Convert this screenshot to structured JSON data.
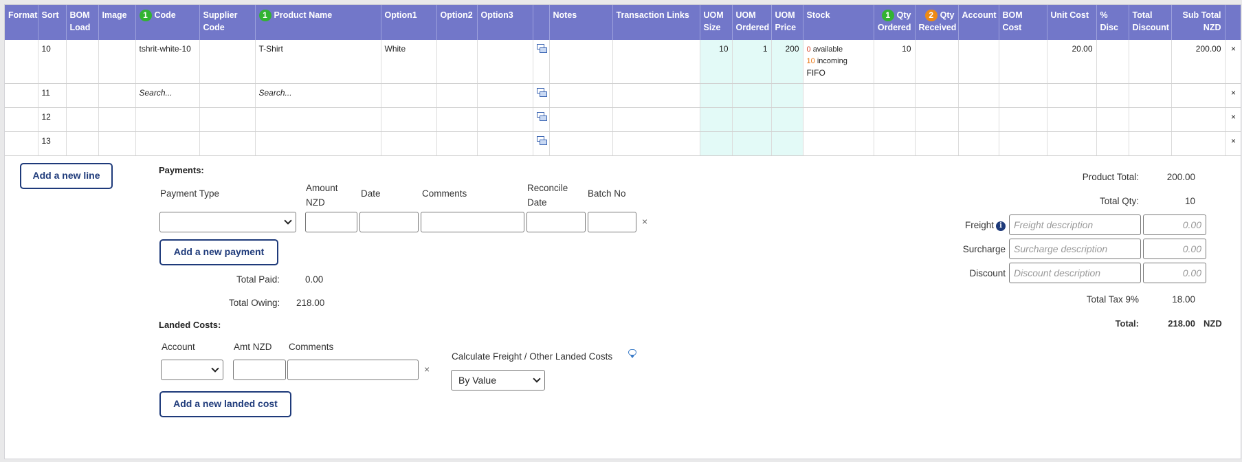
{
  "columns": [
    {
      "key": "format",
      "label": "Format"
    },
    {
      "key": "sort",
      "label": "Sort"
    },
    {
      "key": "bom_load",
      "label": "BOM Load"
    },
    {
      "key": "image",
      "label": "Image"
    },
    {
      "key": "code",
      "label": "Code",
      "badge": "1",
      "badge_color": "green"
    },
    {
      "key": "supplier_code",
      "label": "Supplier Code"
    },
    {
      "key": "product_name",
      "label": "Product Name",
      "badge": "1",
      "badge_color": "green"
    },
    {
      "key": "option1",
      "label": "Option1"
    },
    {
      "key": "option2",
      "label": "Option2"
    },
    {
      "key": "option3",
      "label": "Option3"
    },
    {
      "key": "note_icon",
      "label": ""
    },
    {
      "key": "notes",
      "label": "Notes"
    },
    {
      "key": "transaction_links",
      "label": "Transaction Links"
    },
    {
      "key": "uom_size",
      "label": "UOM Size"
    },
    {
      "key": "uom_ordered",
      "label": "UOM Ordered"
    },
    {
      "key": "uom_price",
      "label": "UOM Price"
    },
    {
      "key": "stock",
      "label": "Stock"
    },
    {
      "key": "qty_ordered",
      "label": "Qty Ordered",
      "badge": "1",
      "badge_color": "green"
    },
    {
      "key": "qty_received",
      "label": "Qty Received",
      "badge": "2",
      "badge_color": "orange"
    },
    {
      "key": "account",
      "label": "Account"
    },
    {
      "key": "bom_cost",
      "label": "BOM Cost"
    },
    {
      "key": "unit_cost",
      "label": "Unit Cost"
    },
    {
      "key": "pct_disc",
      "label": "% Disc"
    },
    {
      "key": "total_discount",
      "label": "Total Discount"
    },
    {
      "key": "sub_total",
      "label": "Sub Total NZD"
    },
    {
      "key": "remove",
      "label": ""
    }
  ],
  "rows": [
    {
      "sort": "10",
      "code": "tshrit-white-10",
      "product_name": "T-Shirt",
      "option1": "White",
      "uom_size": "10",
      "uom_ordered": "1",
      "uom_price": "200",
      "stock": {
        "available_num": "0",
        "available_label": "available",
        "incoming_num": "10",
        "incoming_label": "incoming",
        "method": "FIFO"
      },
      "qty_ordered": "10",
      "unit_cost": "20.00",
      "sub_total": "200.00",
      "remove": "×"
    },
    {
      "sort": "11",
      "code_placeholder": "Search...",
      "product_placeholder": "Search...",
      "remove": "×"
    },
    {
      "sort": "12",
      "remove": "×"
    },
    {
      "sort": "13",
      "remove": "×"
    }
  ],
  "add_line_button": "Add a new line",
  "payments": {
    "title": "Payments:",
    "headers": {
      "payment_type": "Payment Type",
      "amount_line1": "Amount",
      "amount_line2": "NZD",
      "date": "Date",
      "comments": "Comments",
      "reconcile_line1": "Reconcile",
      "reconcile_line2": "Date",
      "batch_no": "Batch No"
    },
    "remove": "×",
    "add_button": "Add a new payment",
    "total_paid_label": "Total Paid:",
    "total_paid": "0.00",
    "total_owing_label": "Total Owing:",
    "total_owing": "218.00"
  },
  "landed_costs": {
    "title": "Landed Costs:",
    "headers": {
      "account": "Account",
      "amt": "Amt NZD",
      "comments": "Comments"
    },
    "remove": "×",
    "add_button": "Add a new landed cost",
    "calc_label": "Calculate Freight / Other Landed Costs",
    "calc_value": "By Value"
  },
  "totals": {
    "product_total_label": "Product Total:",
    "product_total": "200.00",
    "total_qty_label": "Total Qty:",
    "total_qty": "10",
    "freight_label": "Freight",
    "freight_placeholder": "Freight description",
    "freight_amount_placeholder": "0.00",
    "surcharge_label": "Surcharge",
    "surcharge_placeholder": "Surcharge description",
    "surcharge_amount_placeholder": "0.00",
    "discount_label": "Discount",
    "discount_placeholder": "Discount description",
    "discount_amount_placeholder": "0.00",
    "tax_label": "Total Tax 9%",
    "tax": "18.00",
    "total_label": "Total:",
    "total": "218.00",
    "currency": "NZD"
  },
  "colors": {
    "header_bg": "#7277c9",
    "uom_bg": "#e3faf7",
    "button_border": "#1e3a7a",
    "badge_green": "#32b332",
    "badge_orange": "#ee8a14"
  }
}
